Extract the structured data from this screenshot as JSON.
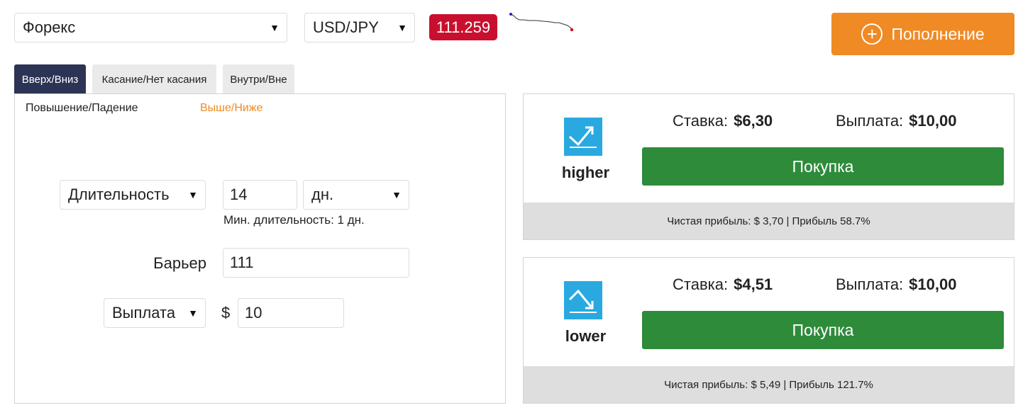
{
  "market": {
    "value": "Форекс"
  },
  "symbol": {
    "value": "USD/JPY"
  },
  "spot_price": "111.259",
  "deposit": {
    "label": "Пополнение"
  },
  "tabs": [
    {
      "label": "Вверх/Вниз",
      "active": true
    },
    {
      "label": "Касание/Нет касания",
      "active": false
    },
    {
      "label": "Внутри/Вне",
      "active": false
    }
  ],
  "subtabs": [
    {
      "label": "Повышение/Падение",
      "active": false
    },
    {
      "label": "Выше/Ниже",
      "active": true
    }
  ],
  "form": {
    "duration": {
      "selector": "Длительность",
      "value": "14",
      "unit": "дн.",
      "hint": "Мин. длительность: 1 дн."
    },
    "barrier": {
      "label": "Барьер",
      "value": "111"
    },
    "payout": {
      "selector": "Выплата",
      "currency_symbol": "$",
      "value": "10"
    }
  },
  "contracts": [
    {
      "name": "higher",
      "stake_label": "Ставка:",
      "stake_value": "$6,30",
      "payout_label": "Выплата:",
      "payout_value": "$10,00",
      "buy_label": "Покупка",
      "profit_text": "Чистая прибыль: $ 3,70 | Прибыль 58.7%",
      "icon": "arrow-up-icon"
    },
    {
      "name": "lower",
      "stake_label": "Ставка:",
      "stake_value": "$4,51",
      "payout_label": "Выплата:",
      "payout_value": "$10,00",
      "buy_label": "Покупка",
      "profit_text": "Чистая прибыль: $ 5,49 | Прибыль 121.7%",
      "icon": "arrow-down-icon"
    }
  ],
  "colors": {
    "accent_orange": "#f08a24",
    "active_tab": "#2c3456",
    "price_badge": "#c8102e",
    "buy_green": "#2e8b3a",
    "icon_blue": "#29a9e0"
  }
}
